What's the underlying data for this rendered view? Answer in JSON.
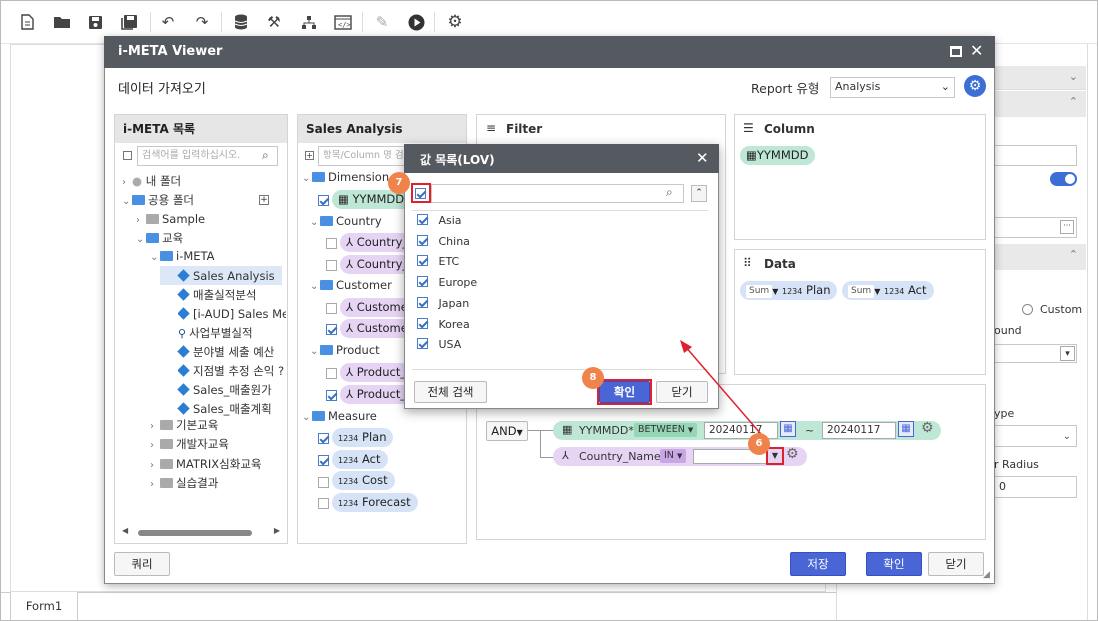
{
  "toolbar": {
    "icons": [
      "new-document-icon",
      "open-folder-icon",
      "save-icon",
      "save-as-icon",
      "undo-icon",
      "redo-icon",
      "database-icon",
      "tools-icon",
      "hierarchy-icon",
      "code-icon",
      "edit-icon",
      "play-icon",
      "gear-icon"
    ]
  },
  "bottom_tab": {
    "label": "Form1"
  },
  "right_panel": {
    "custom_label": "Custom",
    "round_label": "ound",
    "type_label": "ype",
    "radius_label": "r Radius",
    "radius_value": "0"
  },
  "viewer": {
    "title": "i-META Viewer",
    "subtitle": "데이터 가져오기",
    "report_type_label": "Report 유형",
    "report_type_value": "Analysis",
    "meta_list": {
      "header": "i-META 목록",
      "search_placeholder": "검색어를 입력하십시오.",
      "items": [
        {
          "label": "내 폴더"
        },
        {
          "label": "공용 폴더"
        },
        {
          "label": "Sample"
        },
        {
          "label": "교육"
        },
        {
          "label": "i-META"
        },
        {
          "label": "Sales Analysis"
        },
        {
          "label": "매출실적분석"
        },
        {
          "label": "[i-AUD] Sales Meta"
        },
        {
          "label": "사업부별실적"
        },
        {
          "label": "분야별 세출 예산"
        },
        {
          "label": "지점별 추정 손익 ?"
        },
        {
          "label": "Sales_매출원가"
        },
        {
          "label": "Sales_매출계획"
        },
        {
          "label": "기본교육"
        },
        {
          "label": "개발자교육"
        },
        {
          "label": "MATRIX심화교육"
        },
        {
          "label": "실습결과"
        }
      ]
    },
    "sales": {
      "header": "Sales Analysis",
      "search_placeholder": "항목/Column 명 검색",
      "dimension": "Dimension",
      "yymmdd": "YYMMDD",
      "country": "Country",
      "country1": "Country_",
      "country2": "Country_",
      "customer": "Customer",
      "customer1": "Custome",
      "customer2": "Custome",
      "product": "Product",
      "product1": "Product_",
      "product2": "Product_",
      "measure": "Measure",
      "plan": "Plan",
      "act": "Act",
      "cost": "Cost",
      "forecast": "Forecast"
    },
    "filter": {
      "header": "Filter",
      "and_label": "AND",
      "cond1": {
        "field": "YYMMDD*",
        "op": "BETWEEN",
        "from": "20240117",
        "tilde": "~",
        "to": "20240117"
      },
      "cond2": {
        "field": "Country_Name*",
        "op": "IN",
        "value": ""
      }
    },
    "column": {
      "header": "Column",
      "item": "YYMMDD"
    },
    "data": {
      "header": "Data",
      "items": [
        {
          "agg": "Sum",
          "name": "Plan"
        },
        {
          "agg": "Sum",
          "name": "Act"
        }
      ]
    },
    "buttons": {
      "query": "쿼리",
      "save": "저장",
      "ok": "확인",
      "close": "닫기"
    }
  },
  "lov": {
    "title": "값 목록(LOV)",
    "search_value": "",
    "items": [
      "Asia",
      "China",
      "ETC",
      "Europe",
      "Japan",
      "Korea",
      "USA"
    ],
    "search_all": "전체 검색",
    "ok": "확인",
    "close": "닫기"
  },
  "badges": {
    "b6": "6",
    "b7": "7",
    "b8": "8"
  },
  "accent_color": "#4a66d6",
  "callout_color": "#e0202c"
}
